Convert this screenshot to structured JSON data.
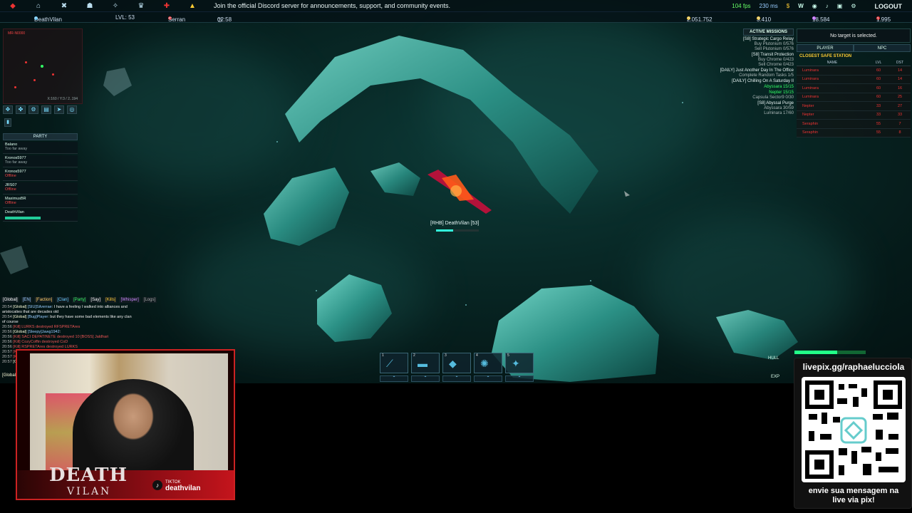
{
  "topbar": {
    "announcement": "Join the official Discord server for announcements, support, and community events.",
    "fps": "104 fps",
    "ping": "230 ms",
    "logout": "LOGOUT"
  },
  "infobar": {
    "player": "DeathVilan",
    "level": "LVL: 53",
    "map": "Serran",
    "time": "02:58",
    "credits": "2.051.752",
    "uridium": "3.410",
    "honor": "18.584",
    "premium": "1.995"
  },
  "minimap": {
    "zone": "MR-N0000",
    "coords": "X:160 / Y:3 / 2..194"
  },
  "party": {
    "title": "PARTY",
    "members": [
      {
        "name": "Balano",
        "status": "Too far away",
        "offline": false
      },
      {
        "name": "Kronos5977",
        "status": "Too far away",
        "offline": false
      },
      {
        "name": "Kronos5977",
        "status": "Offline",
        "offline": true
      },
      {
        "name": "JRS07",
        "status": "Offline",
        "offline": true
      },
      {
        "name": "MaximusBR",
        "status": "Offline",
        "offline": true
      },
      {
        "name": "DeathVilan",
        "status": "",
        "offline": false
      }
    ]
  },
  "chat": {
    "tabs": [
      "[Global]",
      "[EN]",
      "[Faction]",
      "[Clan]",
      "[Party]",
      "[Say]",
      "[Kills]",
      "[Whisper]",
      "[Logs]"
    ],
    "lines": [
      {
        "t": "20:54",
        "ch": "[Global]",
        "who": "[SIU]Silverrae",
        "msg": ": I have a feeling I walked into alliances and"
      },
      {
        "t": "",
        "ch": "",
        "who": "",
        "msg": "aristocaties that are decades old"
      },
      {
        "t": "20:54",
        "ch": "[Global]",
        "who": "[Bug]Player",
        "msg": ": but they have some bad elements like any clan"
      },
      {
        "t": "",
        "ch": "",
        "who": "",
        "msg": "of course"
      },
      {
        "t": "20:56",
        "ch": "[Kill]",
        "who": "",
        "msg": "LURKS destroyed RFSPRETAres"
      },
      {
        "t": "20:56",
        "ch": "[Global]",
        "who": "[Sleepy]Jawg1942",
        "msg": ":"
      },
      {
        "t": "20:56",
        "ch": "[Kill]",
        "who": "",
        "msg": "SACI DEPATINETE destroyed 10 [BOSS] Jaldhari"
      },
      {
        "t": "20:56",
        "ch": "[Kill]",
        "who": "",
        "msg": "CozyCoffin destroyed CoD"
      },
      {
        "t": "20:56",
        "ch": "[Kill]",
        "who": "",
        "msg": "RSPRETAres destroyed LURKS"
      },
      {
        "t": "20:57",
        "ch": "[Kill]",
        "who": "",
        "msg": ""
      },
      {
        "t": "20:57",
        "ch": "[Kill]",
        "who": "",
        "msg": ""
      },
      {
        "t": "20:57",
        "ch": "[Global]",
        "who": "",
        "msg": ""
      }
    ],
    "input_prefix": "[Global]"
  },
  "missions": {
    "header": "ACTIVE MISSIONS",
    "items": [
      {
        "text": "[S8] Strategic Cargo Relay",
        "cls": ""
      },
      {
        "text": "Buy Plutonium 0/576",
        "cls": "sub"
      },
      {
        "text": "Sell Plutonium 0/576",
        "cls": "sub"
      },
      {
        "text": "[S8] Transit Protection",
        "cls": ""
      },
      {
        "text": "Buy Chrome 0/423",
        "cls": "sub"
      },
      {
        "text": "Sell Chrome 0/423",
        "cls": "sub"
      },
      {
        "text": "[DAILY] Just Another Day In The Office",
        "cls": ""
      },
      {
        "text": "Complete Random Tasks 1/5",
        "cls": "sub"
      },
      {
        "text": "[DAILY] Chilling On A Saturday II",
        "cls": ""
      },
      {
        "text": "Abyssara 15/15",
        "cls": "green"
      },
      {
        "text": "Nepter 15/15",
        "cls": "green"
      },
      {
        "text": "Capsula Sector9 0/30",
        "cls": "sub"
      },
      {
        "text": "[S8] Abyssal Purge",
        "cls": ""
      },
      {
        "text": "Abyssara 30/59",
        "cls": "sub"
      },
      {
        "text": "Luminara 17/60",
        "cls": "sub"
      }
    ]
  },
  "target": {
    "no_target": "No target is selected.",
    "tab_player": "PLAYER",
    "tab_npc": "NPC",
    "safe_station": "CLOSEST SAFE STATION",
    "col_name": "NAME",
    "col_lvl": "LVL",
    "col_dst": "DST",
    "npcs": [
      {
        "name": "Luminara",
        "lvl": "60",
        "dst": "14"
      },
      {
        "name": "Luminara",
        "lvl": "60",
        "dst": "14"
      },
      {
        "name": "Luminara",
        "lvl": "60",
        "dst": "16"
      },
      {
        "name": "Luminara",
        "lvl": "60",
        "dst": "25"
      },
      {
        "name": "Nepter",
        "lvl": "33",
        "dst": "27"
      },
      {
        "name": "Nepter",
        "lvl": "33",
        "dst": "33"
      },
      {
        "name": "Seraphin",
        "lvl": "55",
        "dst": "7"
      },
      {
        "name": "Seraphin",
        "lvl": "55",
        "dst": "8"
      }
    ]
  },
  "ship": {
    "label": "[RHB] DeathVilan [53]",
    "health": 0.4
  },
  "hotbar": {
    "slots": [
      {
        "n": "1",
        "g": "⟋"
      },
      {
        "n": "2",
        "g": "▬"
      },
      {
        "n": "3",
        "g": "◆"
      },
      {
        "n": "4",
        "g": "✺"
      },
      {
        "n": "5",
        "g": "✦"
      }
    ],
    "sub": [
      "⌃",
      "⌃",
      "⌃",
      "⌃",
      "⌃"
    ]
  },
  "hud": {
    "hull": "HULL",
    "exp": "EXP",
    "hull_level": 0.6
  },
  "webcam": {
    "logo_top": "DEATH",
    "logo_bottom": "VILAN",
    "tiktok_label": "TIKTOK",
    "tiktok_handle": "deathvilan"
  },
  "pix": {
    "url": "livepix.gg/raphaelucciola",
    "message_line1": "envie sua mensagem na",
    "message_line2": "live via pix!"
  }
}
